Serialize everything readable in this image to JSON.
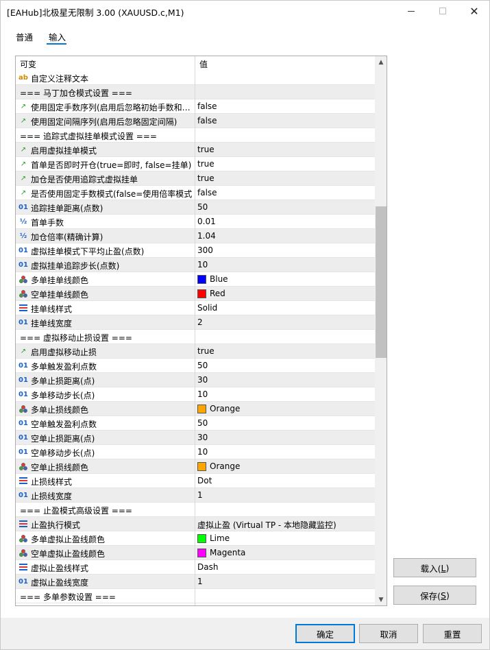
{
  "window": {
    "title": "[EAHub]北极星无限制 3.00 (XAUUSD.c,M1)"
  },
  "tabs": [
    {
      "label": "普通"
    },
    {
      "label": "输入"
    }
  ],
  "grid": {
    "col_variable": "可变",
    "col_value": "值",
    "rows": [
      {
        "icon": "ab",
        "name": "自定义注释文本",
        "value": ""
      },
      {
        "icon": "",
        "name": "=== 马丁加仓模式设置 ===",
        "value": ""
      },
      {
        "icon": "bool",
        "name": "使用固定手数序列(启用后忽略初始手数和…",
        "value": "false"
      },
      {
        "icon": "bool",
        "name": "使用固定间隔序列(启用后忽略固定间隔)",
        "value": "false"
      },
      {
        "icon": "",
        "name": "=== 追踪式虚拟挂单模式设置 ===",
        "value": ""
      },
      {
        "icon": "bool",
        "name": "启用虚拟挂单模式",
        "value": "true"
      },
      {
        "icon": "bool",
        "name": "首单是否即时开仓(true=即时, false=挂单)",
        "value": "true"
      },
      {
        "icon": "bool",
        "name": "加仓是否使用追踪式虚拟挂单",
        "value": "true"
      },
      {
        "icon": "bool",
        "name": "是否使用固定手数模式(false=使用倍率模式)",
        "value": "false"
      },
      {
        "icon": "int",
        "name": "追踪挂单距离(点数)",
        "value": "50"
      },
      {
        "icon": "dbl",
        "name": "首单手数",
        "value": "0.01"
      },
      {
        "icon": "dbl",
        "name": "加仓倍率(精确计算)",
        "value": "1.04"
      },
      {
        "icon": "int",
        "name": "虚拟挂单模式下平均止盈(点数)",
        "value": "300"
      },
      {
        "icon": "int",
        "name": "虚拟挂单追踪步长(点数)",
        "value": "10"
      },
      {
        "icon": "color",
        "name": "多单挂单线颜色",
        "value": "Blue",
        "swatch": "#0000ff"
      },
      {
        "icon": "color",
        "name": "空单挂单线颜色",
        "value": "Red",
        "swatch": "#ff0000"
      },
      {
        "icon": "enum",
        "name": "挂单线样式",
        "value": "Solid"
      },
      {
        "icon": "int",
        "name": "挂单线宽度",
        "value": "2"
      },
      {
        "icon": "",
        "name": "=== 虚拟移动止损设置 ===",
        "value": ""
      },
      {
        "icon": "bool",
        "name": "启用虚拟移动止损",
        "value": "true"
      },
      {
        "icon": "int",
        "name": "多单触发盈利点数",
        "value": "50"
      },
      {
        "icon": "int",
        "name": "多单止损距离(点)",
        "value": "30"
      },
      {
        "icon": "int",
        "name": "多单移动步长(点)",
        "value": "10"
      },
      {
        "icon": "color",
        "name": "多单止损线颜色",
        "value": "Orange",
        "swatch": "#ffa500"
      },
      {
        "icon": "int",
        "name": "空单触发盈利点数",
        "value": "50"
      },
      {
        "icon": "int",
        "name": "空单止损距离(点)",
        "value": "30"
      },
      {
        "icon": "int",
        "name": "空单移动步长(点)",
        "value": "10"
      },
      {
        "icon": "color",
        "name": "空单止损线颜色",
        "value": "Orange",
        "swatch": "#ffa500"
      },
      {
        "icon": "enum",
        "name": "止损线样式",
        "value": "Dot"
      },
      {
        "icon": "int",
        "name": "止损线宽度",
        "value": "1"
      },
      {
        "icon": "",
        "name": "=== 止盈模式高级设置 ===",
        "value": ""
      },
      {
        "icon": "enum",
        "name": "止盈执行模式",
        "value": "虚拟止盈 (Virtual TP - 本地隐藏监控)"
      },
      {
        "icon": "color",
        "name": "多单虚拟止盈线颜色",
        "value": "Lime",
        "swatch": "#00ff00"
      },
      {
        "icon": "color",
        "name": "空单虚拟止盈线颜色",
        "value": "Magenta",
        "swatch": "#ff00ff"
      },
      {
        "icon": "enum",
        "name": "虚拟止盈线样式",
        "value": "Dash"
      },
      {
        "icon": "int",
        "name": "虚拟止盈线宽度",
        "value": "1"
      },
      {
        "icon": "",
        "name": "=== 多单参数设置 ===",
        "value": ""
      }
    ]
  },
  "buttons": {
    "load": "载入(",
    "load_key": "L",
    "load_end": ")",
    "save": "保存(",
    "save_key": "S",
    "save_end": ")",
    "ok": "确定",
    "cancel": "取消",
    "reset": "重置"
  }
}
